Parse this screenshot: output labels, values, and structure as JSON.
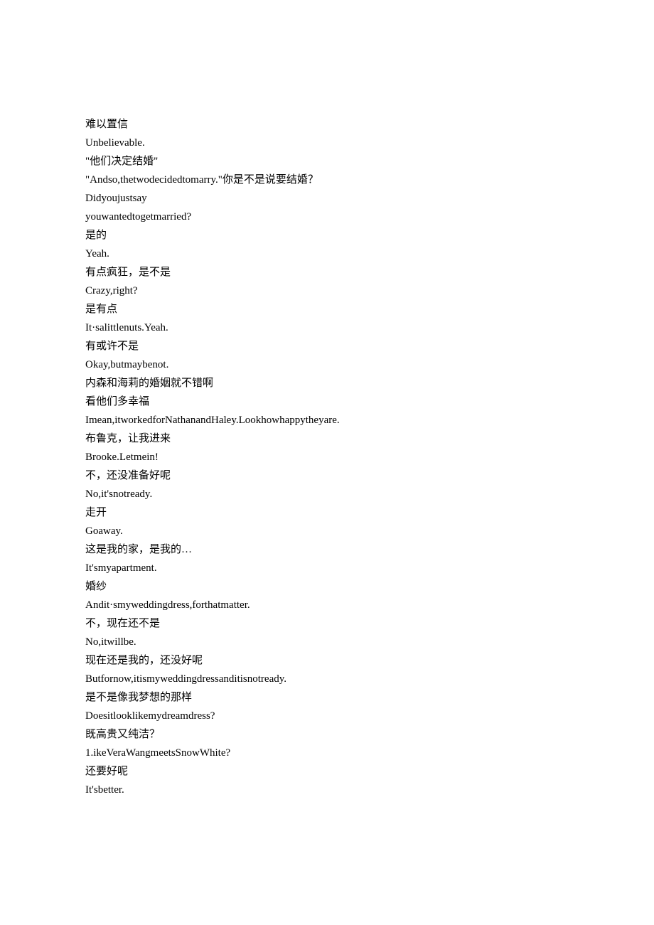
{
  "lines": [
    "难以置信",
    "Unbelievable.",
    "\"他们决定结婚\"",
    "\"Andso,thetwodecidedtomarry.\"你是不是说要结婚？",
    "Didyoujustsay",
    "youwantedtogetmarried?",
    "是的",
    "Yeah.",
    "有点疯狂，是不是",
    "Crazy,right?",
    "是有点",
    "It·salittlenuts.Yeah.",
    "有或许不是",
    "Okay,butmaybenot.",
    "内森和海莉的婚姻就不错啊",
    "看他们多幸福",
    "Imean,itworkedforNathanandHaley.Lookhowhappytheyare.",
    "布鲁克，让我进来",
    "Brooke.Letmein!",
    "不，还没准备好呢",
    "No,it'snotready.",
    "走开",
    "Goaway.",
    "这是我的家，是我的…",
    "It'smyapartment.",
    "婚纱",
    "Andit·smyweddingdress,forthatmatter.",
    "不，现在还不是",
    "No,itwillbe.",
    "现在还是我的，还没好呢",
    "Butfornow,itismyweddingdressanditisnotready.",
    "是不是像我梦想的那样",
    "Doesitlooklikemydreamdress?",
    "既高贵又纯洁？",
    "1.ikeVeraWangmeetsSnowWhite?",
    "还要好呢",
    "It'sbetter."
  ]
}
